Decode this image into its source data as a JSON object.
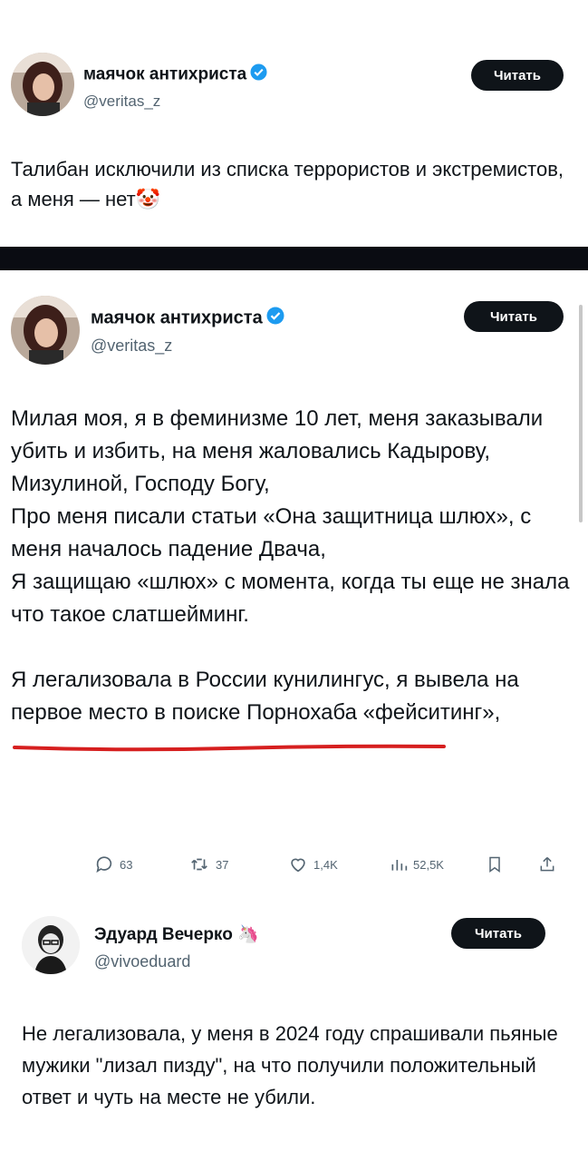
{
  "colors": {
    "follow_bg": "#0f1419",
    "verified": "#1d9bf0",
    "underline": "#d61f1f",
    "handle": "#536471"
  },
  "tweet1": {
    "author_name": "маячок антихриста",
    "handle": "@veritas_z",
    "follow_label": "Читать",
    "verified_icon": "verified-badge-icon",
    "text": "Талибан исключили из списка террористов и экстремистов, а меня — нет🤡"
  },
  "tweet2": {
    "author_name": "маячок антихриста",
    "handle": "@veritas_z",
    "follow_label": "Читать",
    "verified_icon": "verified-badge-icon",
    "paragraph1": "Милая моя, я в феминизме 10 лет, меня заказывали убить и избить, на меня жаловались Кадырову, Мизулиной, Господу Богу,",
    "paragraph2": "Про меня писали статьи «Она защитница шлюх», с меня началось падение Двача,",
    "paragraph3": "Я защищаю «шлюх» с момента, когда ты еще не знала что такое слатшейминг.",
    "paragraph4": "Я легализовала в России кунилингус, я вывела на первое место в поиске Порнохаба «фейситинг»,",
    "actions": {
      "replies": "63",
      "reposts": "37",
      "likes": "1,4K",
      "views": "52,5K"
    }
  },
  "tweet3": {
    "author_name": "Эдуард Вечерко",
    "name_emoji": "🦄",
    "handle": "@vivoeduard",
    "follow_label": "Читать",
    "text": "Не легализовала, у меня в 2024 году спрашивали пьяные мужики \"лизал пизду\", на что получили положительный ответ и чуть на месте не убили."
  }
}
